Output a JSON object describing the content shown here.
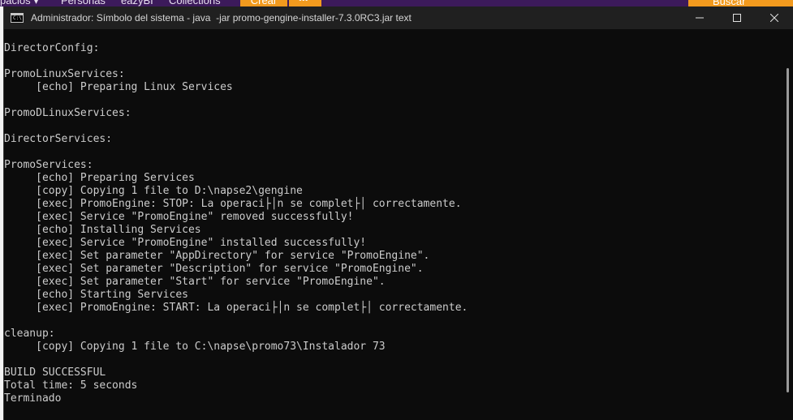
{
  "background_app": {
    "tabs": [
      "pacios ▾",
      "Personas",
      "eazyBI",
      "Collections"
    ],
    "crear_label": "Crear",
    "more_label": "•••",
    "search_label": "Buscar"
  },
  "window": {
    "title": "Administrador: Símbolo del sistema - java  -jar promo-gengine-installer-7.3.0RC3.jar text",
    "icon_label": "C:\\",
    "controls": {
      "minimize": "minimize-icon",
      "maximize": "maximize-icon",
      "close": "close-icon"
    }
  },
  "console": {
    "lines": [
      "DirectorConfig:",
      "",
      "PromoLinuxServices:",
      "     [echo] Preparing Linux Services",
      "",
      "PromoDLinuxServices:",
      "",
      "DirectorServices:",
      "",
      "PromoServices:",
      "     [echo] Preparing Services",
      "     [copy] Copying 1 file to D:\\napse2\\gengine",
      "     [exec] PromoEngine: STOP: La operaci├│n se complet├│ correctamente.",
      "     [exec] Service \"PromoEngine\" removed successfully!",
      "     [echo] Installing Services",
      "     [exec] Service \"PromoEngine\" installed successfully!",
      "     [exec] Set parameter \"AppDirectory\" for service \"PromoEngine\".",
      "     [exec] Set parameter \"Description\" for service \"PromoEngine\".",
      "     [exec] Set parameter \"Start\" for service \"PromoEngine\".",
      "     [echo] Starting Services",
      "     [exec] PromoEngine: START: La operaci├│n se complet├│ correctamente.",
      "",
      "cleanup:",
      "     [copy] Copying 1 file to C:\\napse\\promo73\\Instalador 73",
      "",
      "BUILD SUCCESSFUL",
      "Total time: 5 seconds",
      "Terminado"
    ]
  }
}
